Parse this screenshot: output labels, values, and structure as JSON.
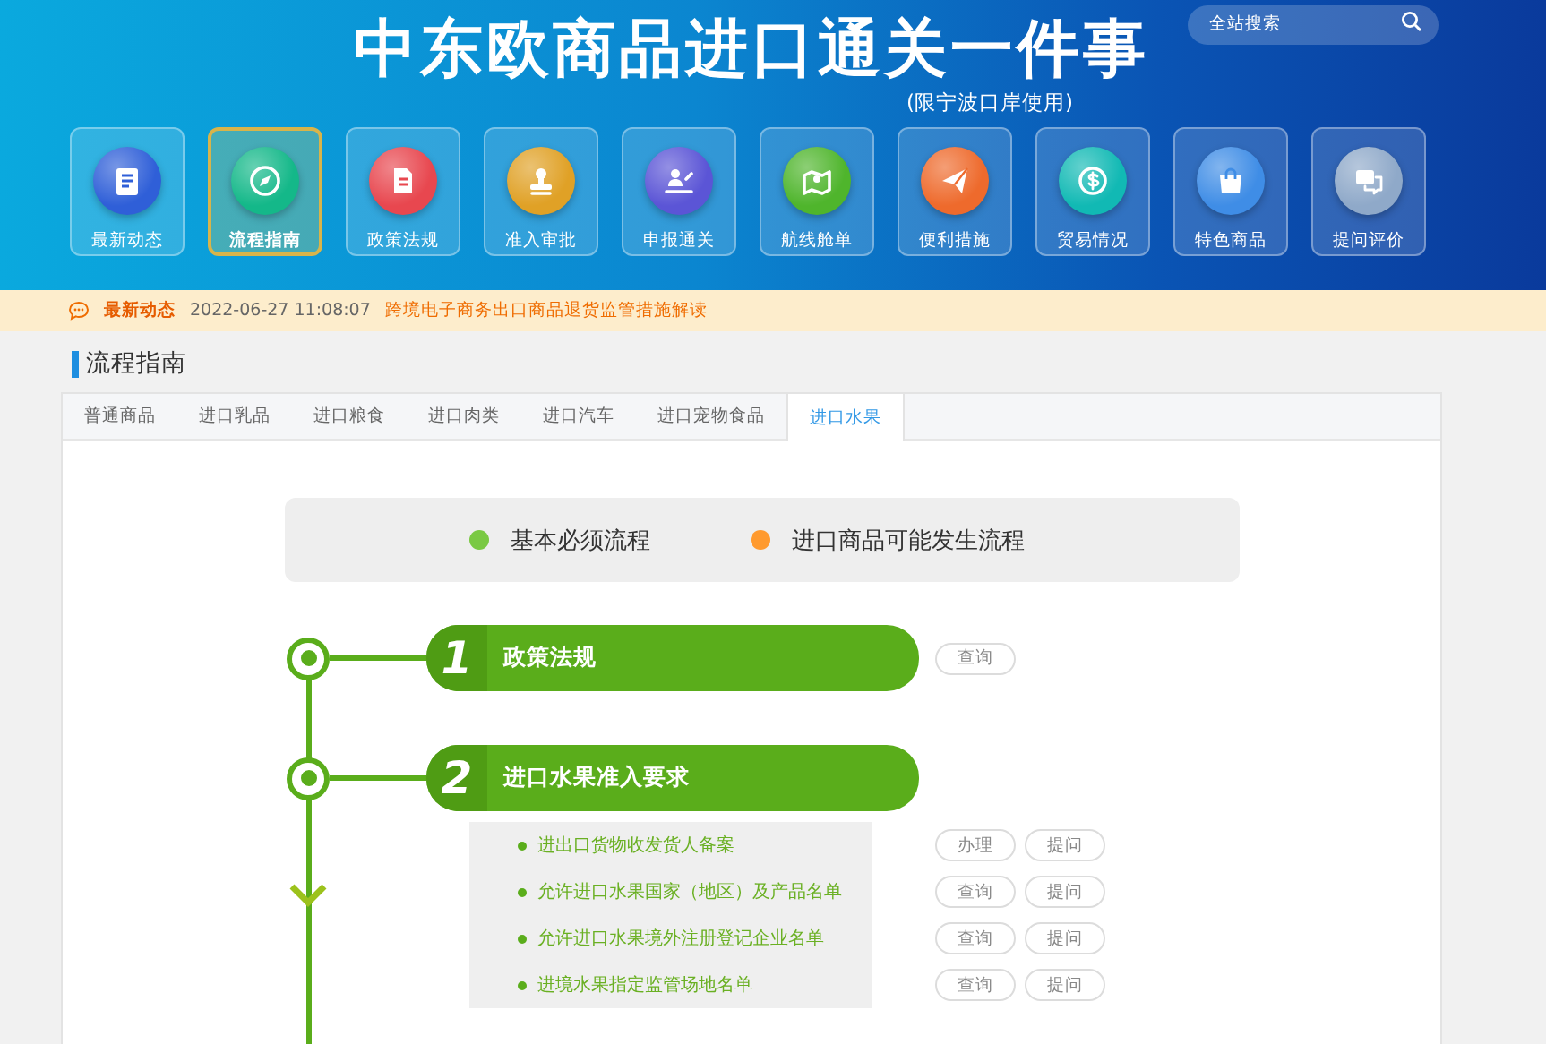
{
  "header": {
    "title": "中东欧商品进口通关一件事",
    "subtitle": "(限宁波口岸使用)",
    "search": {
      "placeholder": "全站搜索"
    }
  },
  "nav": [
    {
      "label": "最新动态",
      "color": "#2f5fd8",
      "selected": false
    },
    {
      "label": "流程指南",
      "color": "#14b889",
      "selected": true
    },
    {
      "label": "政策法规",
      "color": "#e8474f",
      "selected": false
    },
    {
      "label": "准入审批",
      "color": "#e0a126",
      "selected": false
    },
    {
      "label": "申报通关",
      "color": "#5b55d6",
      "selected": false
    },
    {
      "label": "航线舱单",
      "color": "#4fb52c",
      "selected": false
    },
    {
      "label": "便利措施",
      "color": "#ee6a2c",
      "selected": false
    },
    {
      "label": "贸易情况",
      "color": "#11b9b4",
      "selected": false
    },
    {
      "label": "特色商品",
      "color": "#3f8de6",
      "selected": false
    },
    {
      "label": "提问评价",
      "color": "#8fa9c9",
      "selected": false
    }
  ],
  "news": {
    "label": "最新动态",
    "date": "2022-06-27 11:08:07",
    "headline": "跨境电子商务出口商品退货监管措施解读"
  },
  "section_title": "流程指南",
  "tabs": [
    {
      "label": "普通商品",
      "selected": false
    },
    {
      "label": "进口乳品",
      "selected": false
    },
    {
      "label": "进口粮食",
      "selected": false
    },
    {
      "label": "进口肉类",
      "selected": false
    },
    {
      "label": "进口汽车",
      "selected": false
    },
    {
      "label": "进口宠物食品",
      "selected": false
    },
    {
      "label": "进口水果",
      "selected": true
    }
  ],
  "legend": [
    {
      "label": "基本必须流程",
      "color": "#7ac943"
    },
    {
      "label": "进口商品可能发生流程",
      "color": "#ff9a2e"
    }
  ],
  "steps": [
    {
      "number": "1",
      "title": "政策法规",
      "buttons": [
        "查询"
      ]
    },
    {
      "number": "2",
      "title": "进口水果准入要求",
      "items": [
        {
          "text": "进出口货物收发货人备案",
          "buttons": [
            "办理",
            "提问"
          ]
        },
        {
          "text": "允许进口水果国家（地区）及产品名单",
          "buttons": [
            "查询",
            "提问"
          ]
        },
        {
          "text": "允许进口水果境外注册登记企业名单",
          "buttons": [
            "查询",
            "提问"
          ]
        },
        {
          "text": "进境水果指定监管场地名单",
          "buttons": [
            "查询",
            "提问"
          ]
        }
      ]
    }
  ]
}
